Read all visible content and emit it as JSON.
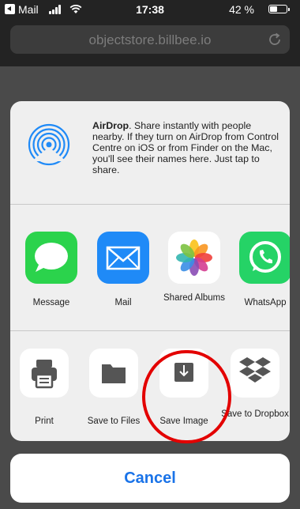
{
  "status_bar": {
    "back_label": "Mail",
    "time": "17:38",
    "battery_percent": "42 %",
    "battery_level": 0.42
  },
  "url_bar": {
    "url": "objectstore.billbee.io",
    "reload_icon": "reload-icon"
  },
  "airdrop": {
    "title": "AirDrop",
    "description": ". Share instantly with people nearby. If they turn on AirDrop from Control Centre on iOS or from Finder on the Mac, you'll see their names here. Just tap to share.",
    "icon": "airdrop-icon"
  },
  "apps": [
    {
      "label": "Message",
      "icon": "messages-icon",
      "color": "#2bd34c"
    },
    {
      "label": "Mail",
      "icon": "mail-icon",
      "color": "#1f8af7"
    },
    {
      "label": "Shared Albums",
      "icon": "photos-icon",
      "color": "#ffffff"
    },
    {
      "label": "WhatsApp",
      "icon": "whatsapp-icon",
      "color": "#25d366"
    }
  ],
  "actions": [
    {
      "label": "Print",
      "icon": "printer-icon"
    },
    {
      "label": "Save to Files",
      "icon": "folder-icon"
    },
    {
      "label": "Save Image",
      "icon": "save-image-icon"
    },
    {
      "label": "Save to Dropbox",
      "icon": "dropbox-icon"
    }
  ],
  "cancel_label": "Cancel",
  "accent_color": "#1a73e8",
  "highlight_color": "#e30000"
}
